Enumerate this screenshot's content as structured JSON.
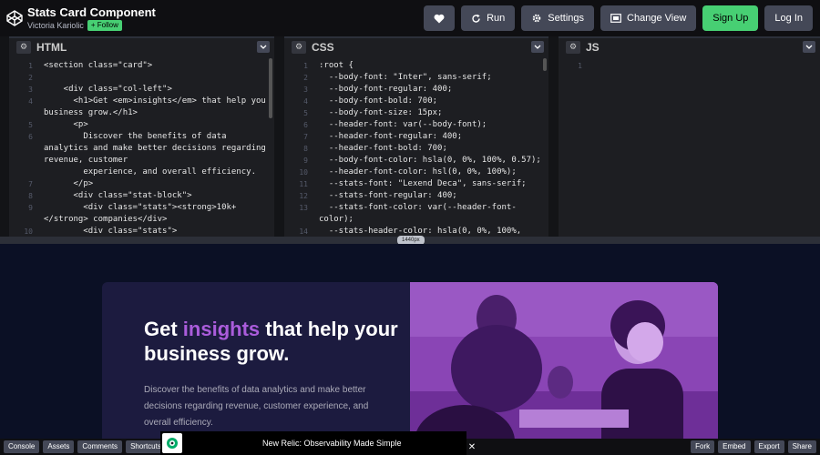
{
  "header": {
    "pen_title": "Stats Card Component",
    "author": "Victoria Kariolic",
    "follow_label": "+ Follow",
    "pencil_glyph": "✎",
    "buttons": {
      "like_icon": "heart-icon",
      "run": "Run",
      "settings": "Settings",
      "change_view": "Change View",
      "signup": "Sign Up",
      "login": "Log In"
    }
  },
  "editors": {
    "html": {
      "label": "HTML",
      "line_numbers": [
        "1",
        "2",
        "3",
        "4",
        "",
        "5",
        "6",
        "",
        "",
        "",
        "7",
        "8",
        "9",
        "",
        "10"
      ],
      "lines": [
        "<section class=\"card\">",
        "",
        "    <div class=\"col-left\">",
        "      <h1>Get <em>insights</em> that help your",
        "business grow.</h1>",
        "      <p>",
        "        Discover the benefits of data",
        "analytics and make better decisions regarding",
        "revenue, customer",
        "        experience, and overall efficiency.",
        "      </p>",
        "      <div class=\"stat-block\">",
        "        <div class=\"stats\"><strong>10k+",
        "</strong> companies</div>",
        "        <div class=\"stats\">"
      ]
    },
    "css": {
      "label": "CSS",
      "line_numbers": [
        "1",
        "2",
        "3",
        "4",
        "5",
        "6",
        "7",
        "8",
        "9",
        "10",
        "11",
        "12",
        "13",
        "",
        "14"
      ],
      "lines": [
        ":root {",
        "  --body-font: \"Inter\", sans-serif;",
        "  --body-font-regular: 400;",
        "  --body-font-bold: 700;",
        "  --body-font-size: 15px;",
        "  --header-font: var(--body-font);",
        "  --header-font-regular: 400;",
        "  --header-font-bold: 700;",
        "  --body-font-color: hsla(0, 0%, 100%, 0.57);",
        "  --header-font-color: hsl(0, 0%, 100%);",
        "  --stats-font: \"Lexend Deca\", sans-serif;",
        "  --stats-font-regular: 400;",
        "  --stats-font-color: var(--header-font-",
        "color);",
        "  --stats-header-color: hsla(0, 0%, 100%,"
      ]
    },
    "js": {
      "label": "JS",
      "line_numbers": [
        "1"
      ],
      "lines": [
        ""
      ]
    },
    "size_badge": "1440px"
  },
  "preview": {
    "heading_pre": "Get ",
    "heading_em": "insights",
    "heading_post": " that help your business grow.",
    "paragraph": "Discover the benefits of data analytics and make better decisions regarding revenue, customer experience, and overall efficiency.",
    "accent_color": "#aa5cdb",
    "card_bg": "#1c1b3f",
    "page_bg": "#0b1025"
  },
  "bottombar": {
    "left": [
      "Console",
      "Assets",
      "Comments",
      "Shortcuts"
    ],
    "ad_text": "New Relic: Observability Made Simple",
    "ad_close": "✕",
    "right": [
      "Fork",
      "Embed",
      "Export",
      "Share"
    ]
  }
}
